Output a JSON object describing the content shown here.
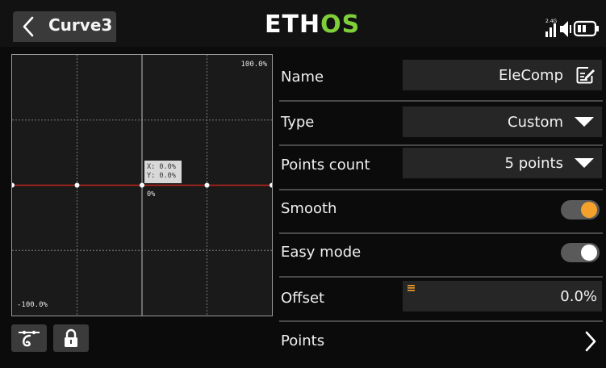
{
  "header": {
    "title": "Curve3",
    "logo_prefix": "ETH",
    "logo_suffix": "OS",
    "radio_band": "2.4G",
    "colors": {
      "logo_accent": "#7fcf3a",
      "background": "#121212"
    }
  },
  "chart": {
    "y_max_label": "100.0%",
    "y_min_label": "-100.0%",
    "cursor_x": "X: 0.0%",
    "cursor_y": "Y: 0.0%",
    "cursor_value": "0%",
    "colors": {
      "curve": "#c0221b",
      "points": "#ffffff",
      "grid": "#7a7a7a"
    }
  },
  "chart_data": {
    "type": "line",
    "x": [
      -100,
      -50,
      0,
      50,
      100
    ],
    "series": [
      {
        "values": [
          0,
          0,
          0,
          0,
          0
        ]
      }
    ],
    "xlim": [
      -100,
      100
    ],
    "ylim": [
      -100,
      100
    ],
    "grid": true
  },
  "tools": [
    {
      "icon": "curve-tool-icon"
    },
    {
      "icon": "lock-icon"
    }
  ],
  "settings": {
    "name": {
      "label": "Name",
      "value": "EleComp",
      "icon": "edit-icon"
    },
    "type": {
      "label": "Type",
      "value": "Custom"
    },
    "points_count": {
      "label": "Points count",
      "value": "5 points"
    },
    "smooth": {
      "label": "Smooth",
      "on": true,
      "color": "#f4a12c"
    },
    "easy_mode": {
      "label": "Easy mode",
      "on": true,
      "color": "#ffffff"
    },
    "offset": {
      "label": "Offset",
      "value": "0.0%"
    },
    "points": {
      "label": "Points"
    }
  }
}
